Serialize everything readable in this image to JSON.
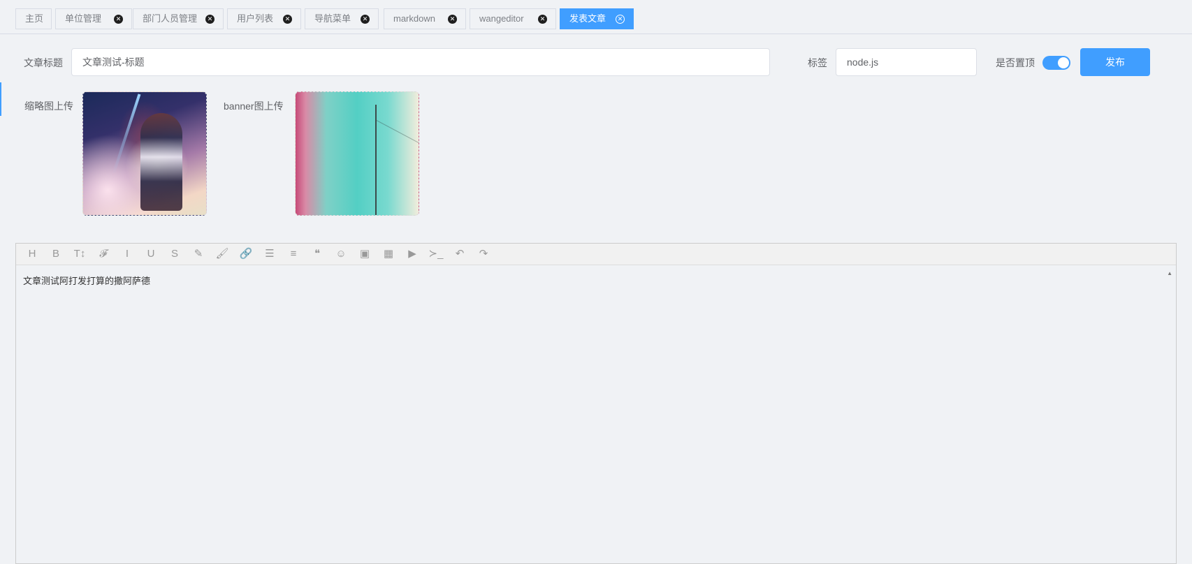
{
  "tabs": [
    {
      "label": "主页",
      "closable": false
    },
    {
      "label": "单位管理",
      "closable": true
    },
    {
      "label": "部门人员管理",
      "closable": true
    },
    {
      "label": "用户列表",
      "closable": true
    },
    {
      "label": "导航菜单",
      "closable": true
    },
    {
      "label": "markdown",
      "closable": true
    },
    {
      "label": "wangeditor",
      "closable": true
    },
    {
      "label": "发表文章",
      "closable": true,
      "active": true
    }
  ],
  "form": {
    "title_label": "文章标题",
    "title_value": "文章测试-标题",
    "tag_label": "标签",
    "tag_value": "node.js",
    "pin_label": "是否置顶",
    "pin_on": true,
    "publish_label": "发布",
    "thumbnail_label": "缩略图上传",
    "banner_label": "banner图上传"
  },
  "editor": {
    "toolbar_icons": [
      "heading-icon",
      "bold-icon",
      "font-size-icon",
      "font-name-icon",
      "italic-icon",
      "underline-icon",
      "strikethrough-icon",
      "fore-color-icon",
      "back-color-icon",
      "link-icon",
      "list-icon",
      "justify-icon",
      "quote-icon",
      "emoticon-icon",
      "image-icon",
      "table-icon",
      "video-icon",
      "code-icon",
      "undo-icon",
      "redo-icon"
    ],
    "toolbar_glyphs": [
      "H",
      "B",
      "T↕",
      "𝓕",
      "I",
      "U",
      "S",
      "✎",
      "🖌",
      "🔗",
      "☰",
      "≡",
      "❝",
      "☺",
      "▣",
      "▦",
      "▶",
      "≻_",
      "↶",
      "↷"
    ],
    "content": "文章测试阿打发打算的撒阿萨德"
  },
  "colors": {
    "accent": "#409eff",
    "background": "#f0f2f5"
  }
}
